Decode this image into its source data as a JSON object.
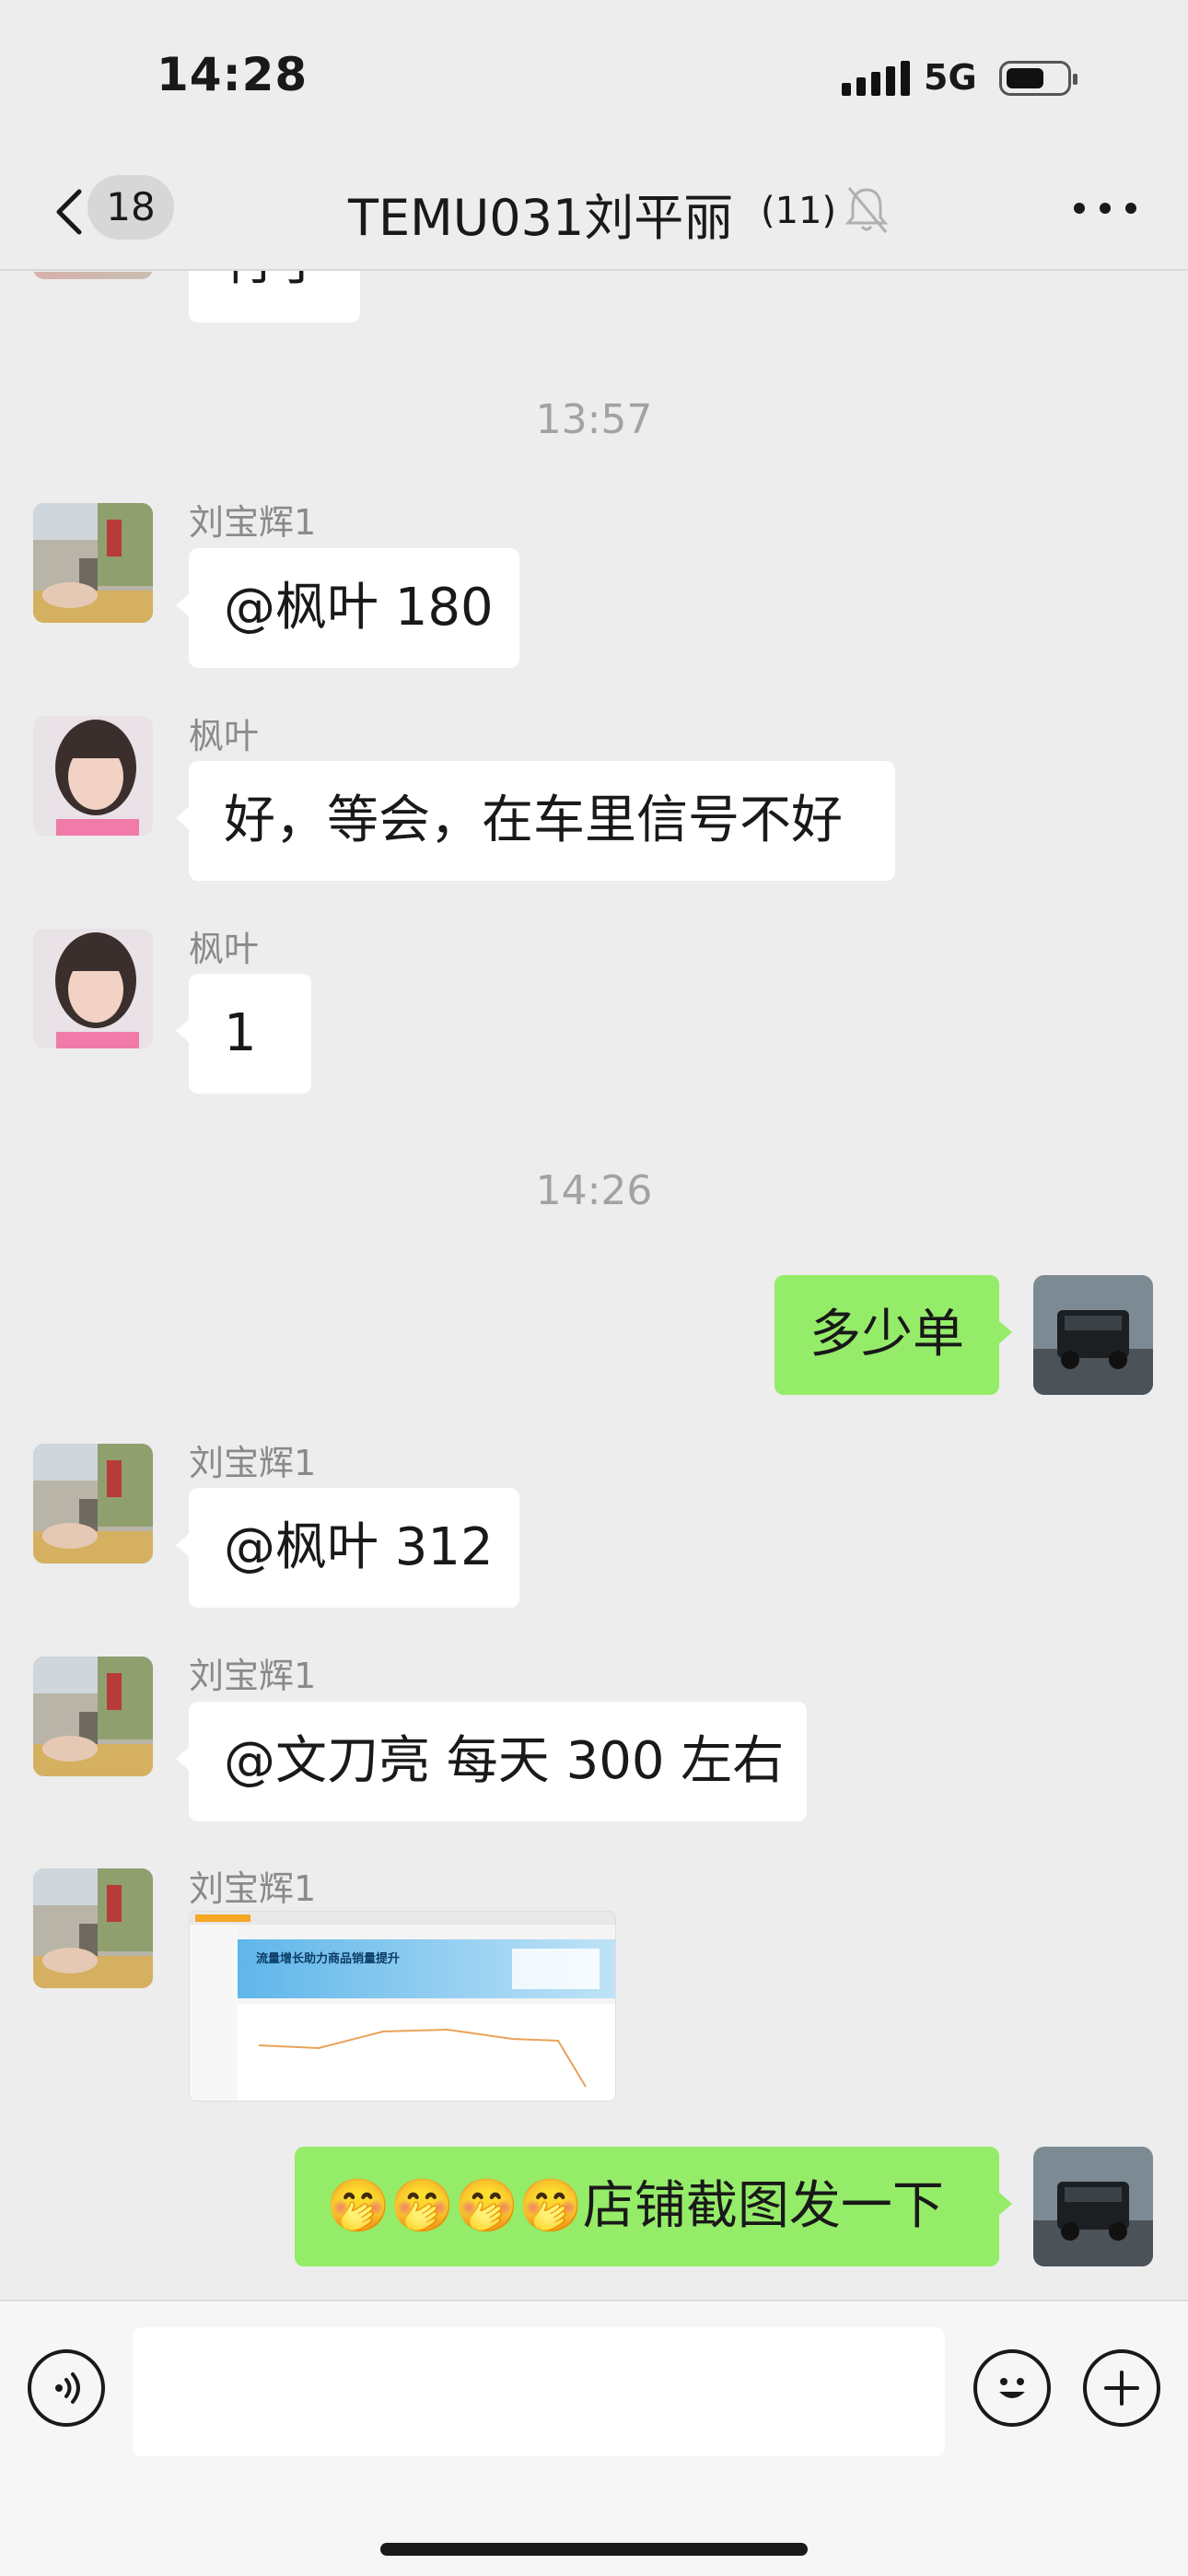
{
  "status_bar": {
    "time": "14:28",
    "network": "5G"
  },
  "header": {
    "back_count": "18",
    "title": "TEMU031刘平丽",
    "member_count": "(11)"
  },
  "messages": [
    {
      "type": "incoming",
      "partial_text": "行了"
    },
    {
      "type": "timestamp",
      "text": "13:57"
    },
    {
      "type": "incoming",
      "sender": "刘宝辉1",
      "text": "@枫叶 180"
    },
    {
      "type": "incoming",
      "sender": "枫叶",
      "text": "好，等会，在车里信号不好"
    },
    {
      "type": "incoming",
      "sender": "枫叶",
      "text": "1"
    },
    {
      "type": "timestamp",
      "text": "14:26"
    },
    {
      "type": "outgoing",
      "text": "多少单"
    },
    {
      "type": "incoming",
      "sender": "刘宝辉1",
      "text": "@枫叶 312"
    },
    {
      "type": "incoming",
      "sender": "刘宝辉1",
      "text": "@文刀亮 每天 300 左右"
    },
    {
      "type": "incoming-image",
      "sender": "刘宝辉1",
      "image_caption": "流量增长助力商品销量提升"
    },
    {
      "type": "outgoing",
      "text": "🤭🤭🤭🤭店铺截图发一下"
    }
  ],
  "colors": {
    "background": "#ededed",
    "outgoing_bubble": "#95ec69",
    "incoming_bubble": "#ffffff"
  },
  "icons": {
    "back": "chevron-left-icon",
    "mute": "bell-slash-icon",
    "more": "more-dots-icon",
    "voice": "voice-icon",
    "emoji": "emoji-icon",
    "add": "plus-circle-icon"
  }
}
